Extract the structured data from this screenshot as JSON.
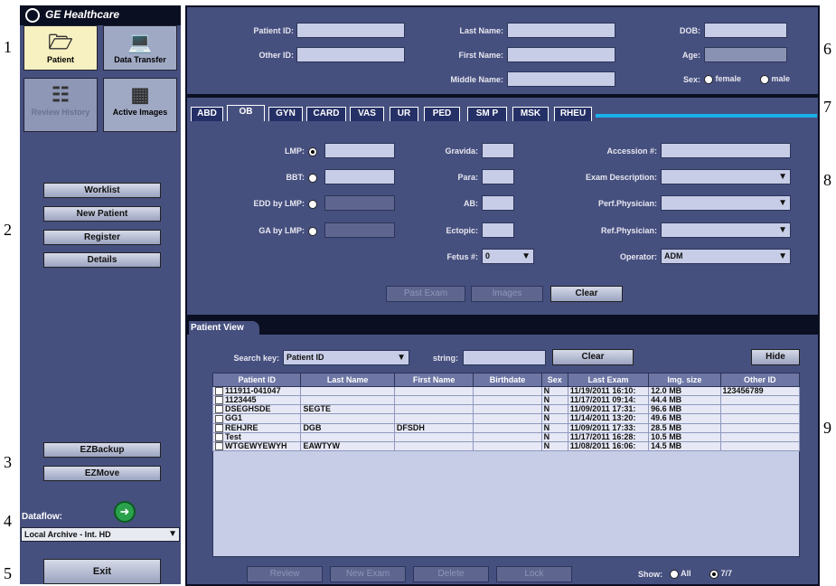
{
  "callouts": [
    "1",
    "2",
    "3",
    "4",
    "5",
    "6",
    "7",
    "8",
    "9"
  ],
  "brand": "GE Healthcare",
  "nav": {
    "patient": "Patient",
    "data_transfer": "Data Transfer",
    "review_history": "Review History",
    "active_images": "Active Images"
  },
  "left_buttons": {
    "worklist": "Worklist",
    "new_patient": "New Patient",
    "register": "Register",
    "details": "Details",
    "ezbackup": "EZBackup",
    "ezmove": "EZMove",
    "exit": "Exit"
  },
  "dataflow": {
    "label": "Dataflow:",
    "selected": "Local Archive - Int. HD"
  },
  "patient_info": {
    "patient_id_label": "Patient ID:",
    "other_id_label": "Other ID:",
    "last_name_label": "Last Name:",
    "first_name_label": "First Name:",
    "middle_name_label": "Middle Name:",
    "dob_label": "DOB:",
    "age_label": "Age:",
    "sex_label": "Sex:",
    "sex_female": "female",
    "sex_male": "male"
  },
  "tabs": [
    "ABD",
    "OB",
    "GYN",
    "CARD",
    "VAS",
    "UR",
    "PED",
    "SM P",
    "MSK",
    "RHEU"
  ],
  "active_tab": "OB",
  "exam": {
    "lmp": "LMP:",
    "bbt": "BBT:",
    "edd_by_lmp": "EDD by LMP:",
    "ga_by_lmp": "GA by LMP:",
    "gravida": "Gravida:",
    "para": "Para:",
    "ab": "AB:",
    "ectopic": "Ectopic:",
    "fetus": "Fetus #:",
    "fetus_value": "0",
    "accession": "Accession #:",
    "exam_description": "Exam Description:",
    "perf_physician": "Perf.Physician:",
    "ref_physician": "Ref.Physician:",
    "operator": "Operator:",
    "operator_value": "ADM",
    "past_exam": "Past Exam",
    "images": "Images",
    "clear": "Clear"
  },
  "patient_view": {
    "title": "Patient View",
    "search_key_label": "Search key:",
    "search_key_value": "Patient ID",
    "string_label": "string:",
    "clear": "Clear",
    "hide": "Hide",
    "columns": [
      "Patient ID",
      "Last Name",
      "First Name",
      "Birthdate",
      "Sex",
      "Last Exam",
      "Img. size",
      "Other ID"
    ],
    "rows": [
      [
        "111911-041047",
        "",
        "",
        "",
        "N",
        "11/19/2011 16:10:",
        "12.0 MB",
        "123456789"
      ],
      [
        "1123445",
        "",
        "",
        "",
        "N",
        "11/17/2011 09:14:",
        "44.4 MB",
        ""
      ],
      [
        "DSEGHSDE",
        "SEGTE",
        "",
        "",
        "N",
        "11/09/2011 17:31:",
        "96.6 MB",
        ""
      ],
      [
        "GG1",
        "",
        "",
        "",
        "N",
        "11/14/2011 13:20:",
        "49.6 MB",
        ""
      ],
      [
        "REHJRE",
        "DGB",
        "DFSDH",
        "",
        "N",
        "11/09/2011 17:33:",
        "28.5 MB",
        ""
      ],
      [
        "Test",
        "",
        "",
        "",
        "N",
        "11/17/2011 16:28:",
        "10.5 MB",
        ""
      ],
      [
        "WTGEWYEWYH",
        "EAWTYW",
        "",
        "",
        "N",
        "11/08/2011 16:06:",
        "14.5 MB",
        ""
      ]
    ],
    "review": "Review",
    "new_exam": "New Exam",
    "delete": "Delete",
    "lock": "Lock",
    "show_label": "Show:",
    "show_all": "All",
    "show_count": "7/7"
  }
}
